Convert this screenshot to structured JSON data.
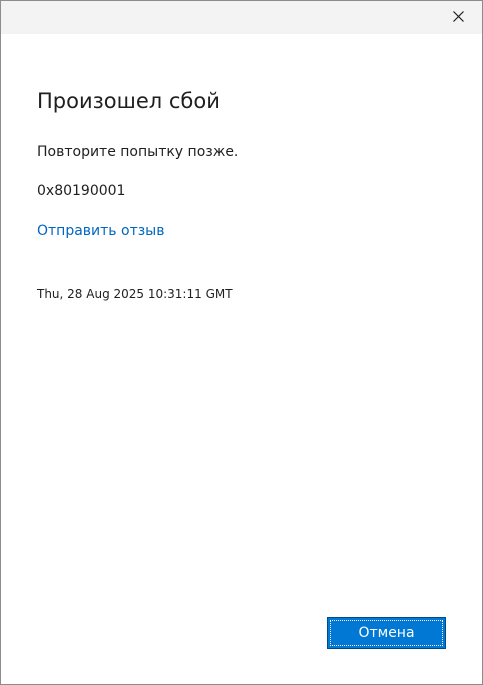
{
  "dialog": {
    "heading": "Произошел сбой",
    "message": "Повторите попытку позже.",
    "error_code": "0x80190001",
    "feedback_link": "Отправить отзыв",
    "timestamp": "Thu, 28 Aug 2025 10:31:11 GMT",
    "cancel_label": "Отмена"
  },
  "titlebar": {
    "close_icon": "close-icon"
  },
  "colors": {
    "accent": "#0078d4",
    "link": "#0067c0",
    "titlebar_bg": "#f3f3f3"
  }
}
